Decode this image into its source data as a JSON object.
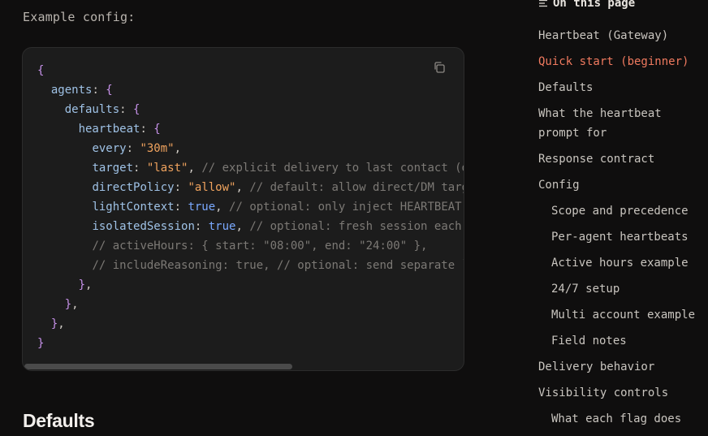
{
  "intro_text": "Example config:",
  "code_lines": [
    [
      {
        "t": "{",
        "c": "br"
      }
    ],
    [
      {
        "t": "  "
      },
      {
        "t": "agents",
        "c": "key"
      },
      {
        "t": ": "
      },
      {
        "t": "{",
        "c": "br"
      }
    ],
    [
      {
        "t": "    "
      },
      {
        "t": "defaults",
        "c": "key"
      },
      {
        "t": ": "
      },
      {
        "t": "{",
        "c": "br"
      }
    ],
    [
      {
        "t": "      "
      },
      {
        "t": "heartbeat",
        "c": "key"
      },
      {
        "t": ": "
      },
      {
        "t": "{",
        "c": "br"
      }
    ],
    [
      {
        "t": "        "
      },
      {
        "t": "every",
        "c": "key"
      },
      {
        "t": ": "
      },
      {
        "t": "\"30m\"",
        "c": "str"
      },
      {
        "t": ","
      }
    ],
    [
      {
        "t": "        "
      },
      {
        "t": "target",
        "c": "key"
      },
      {
        "t": ": "
      },
      {
        "t": "\"last\"",
        "c": "str"
      },
      {
        "t": ", "
      },
      {
        "t": "// explicit delivery to last contact (d",
        "c": "com"
      }
    ],
    [
      {
        "t": "        "
      },
      {
        "t": "directPolicy",
        "c": "key"
      },
      {
        "t": ": "
      },
      {
        "t": "\"allow\"",
        "c": "str"
      },
      {
        "t": ", "
      },
      {
        "t": "// default: allow direct/DM targ",
        "c": "com"
      }
    ],
    [
      {
        "t": "        "
      },
      {
        "t": "lightContext",
        "c": "key"
      },
      {
        "t": ": "
      },
      {
        "t": "true",
        "c": "bool"
      },
      {
        "t": ", "
      },
      {
        "t": "// optional: only inject HEARTBEAT.",
        "c": "com"
      }
    ],
    [
      {
        "t": "        "
      },
      {
        "t": "isolatedSession",
        "c": "key"
      },
      {
        "t": ": "
      },
      {
        "t": "true",
        "c": "bool"
      },
      {
        "t": ", "
      },
      {
        "t": "// optional: fresh session each",
        "c": "com"
      }
    ],
    [
      {
        "t": "        "
      },
      {
        "t": "// activeHours: { start: \"08:00\", end: \"24:00\" },",
        "c": "com"
      }
    ],
    [
      {
        "t": "        "
      },
      {
        "t": "// includeReasoning: true, // optional: send separate `",
        "c": "com"
      }
    ],
    [
      {
        "t": "      "
      },
      {
        "t": "}",
        "c": "br"
      },
      {
        "t": ","
      }
    ],
    [
      {
        "t": "    "
      },
      {
        "t": "}",
        "c": "br"
      },
      {
        "t": ","
      }
    ],
    [
      {
        "t": "  "
      },
      {
        "t": "}",
        "c": "br"
      },
      {
        "t": ","
      }
    ],
    [
      {
        "t": "}",
        "c": "br"
      }
    ]
  ],
  "section_heading": "Defaults",
  "toc": {
    "title": "On this page",
    "items": [
      {
        "label": "Heartbeat (Gateway)",
        "level": 1,
        "active": false
      },
      {
        "label": "Quick start (beginner)",
        "level": 1,
        "active": true
      },
      {
        "label": "Defaults",
        "level": 1,
        "active": false
      },
      {
        "label": "What the heartbeat prompt for",
        "level": 1,
        "active": false,
        "wrap": true
      },
      {
        "label": "Response contract",
        "level": 1,
        "active": false
      },
      {
        "label": "Config",
        "level": 1,
        "active": false
      },
      {
        "label": "Scope and precedence",
        "level": 2,
        "active": false
      },
      {
        "label": "Per-agent heartbeats",
        "level": 2,
        "active": false
      },
      {
        "label": "Active hours example",
        "level": 2,
        "active": false
      },
      {
        "label": "24/7 setup",
        "level": 2,
        "active": false
      },
      {
        "label": "Multi account example",
        "level": 2,
        "active": false
      },
      {
        "label": "Field notes",
        "level": 2,
        "active": false
      },
      {
        "label": "Delivery behavior",
        "level": 1,
        "active": false
      },
      {
        "label": "Visibility controls",
        "level": 1,
        "active": false
      },
      {
        "label": "What each flag does",
        "level": 2,
        "active": false
      }
    ]
  },
  "colors": {
    "accent": "#f07a5f",
    "bg": "#0f0e0e",
    "code_bg": "#1c1c1c"
  },
  "icons": {
    "copy": "copy-icon",
    "toc": "list-icon"
  }
}
